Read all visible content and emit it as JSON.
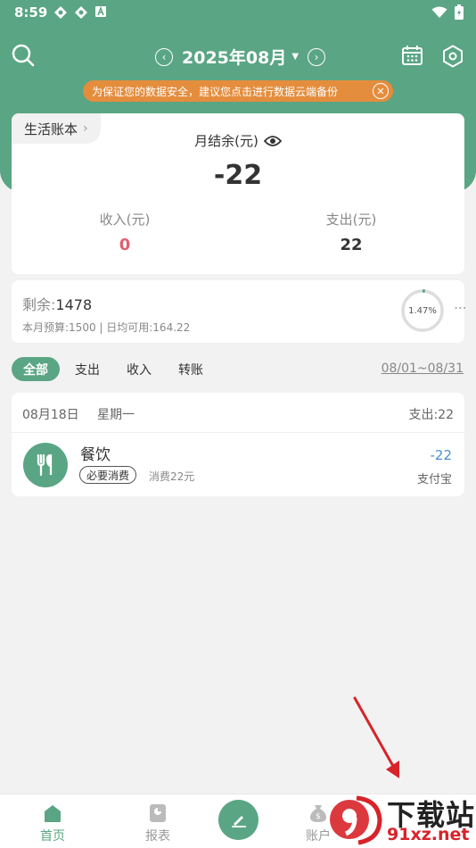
{
  "status_bar": {
    "time": "8:59"
  },
  "header": {
    "month": "2025年08月",
    "notice": "为保证您的数据安全，建议您点击进行数据云端备份"
  },
  "summary": {
    "book_name": "生活账本",
    "balance_label": "月结余(元)",
    "balance_value": "-22",
    "income_label": "收入(元)",
    "income_value": "0",
    "expense_label": "支出(元)",
    "expense_value": "22"
  },
  "budget": {
    "remaining_label": "剩余:",
    "remaining_value": "1478",
    "detail": "本月预算:1500 | 日均可用:164.22",
    "used_percent_text": "1.47%",
    "used_fraction": 0.0147
  },
  "filters": {
    "tabs": [
      "全部",
      "支出",
      "收入",
      "转账"
    ],
    "active_index": 0,
    "date_range": "08/01~08/31"
  },
  "records": {
    "date": "08月18日",
    "weekday": "星期一",
    "day_expense": "支出:22",
    "items": [
      {
        "category": "餐饮",
        "tag": "必要消费",
        "note": "消费22元",
        "amount": "-22",
        "account": "支付宝"
      }
    ]
  },
  "bottom_nav": {
    "home": "首页",
    "reports": "报表",
    "accounts": "账户"
  },
  "watermark": {
    "brand": "下载站",
    "url": "91xz.net"
  },
  "colors": {
    "primary": "#5aa584",
    "notice": "#e48d3d",
    "income": "#e25f6f",
    "amount": "#4a8fcf"
  }
}
